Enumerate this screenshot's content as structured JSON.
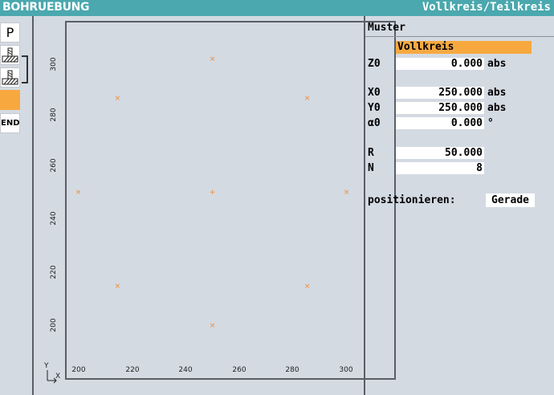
{
  "header": {
    "title": "BOHRUEBUNG",
    "mode": "Vollkreis/Teilkreis"
  },
  "sidebar": {
    "items": [
      {
        "label": "P",
        "icon": "program-icon"
      },
      {
        "icon": "drilling-icon"
      },
      {
        "icon": "drilling-icon"
      },
      {
        "icon": "active-slot"
      },
      {
        "label": "END",
        "icon": "end-icon"
      }
    ]
  },
  "plot": {
    "x_ticks": [
      "200",
      "220",
      "240",
      "260",
      "280",
      "300"
    ],
    "y_ticks": [
      "300",
      "280",
      "260",
      "240",
      "220",
      "200"
    ],
    "axis_x": "X",
    "axis_y": "Y",
    "marker_color": "#f08a30"
  },
  "chart_data": {
    "type": "scatter",
    "x": [
      250,
      285.36,
      300,
      285.36,
      250,
      214.64,
      200,
      214.64,
      250
    ],
    "y": [
      300,
      285.36,
      250,
      214.64,
      200,
      214.64,
      250,
      285.36,
      250
    ],
    "xlim": [
      195,
      305
    ],
    "ylim": [
      190,
      315
    ]
  },
  "panel": {
    "heading": "Muster",
    "pattern": "Vollkreis",
    "fields": [
      {
        "label": "Z0",
        "value": "0.000",
        "unit": "abs"
      },
      {
        "label": "X0",
        "value": "250.000",
        "unit": "abs"
      },
      {
        "label": "Y0",
        "value": "250.000",
        "unit": "abs"
      },
      {
        "label": "α0",
        "value": "0.000",
        "unit": "°"
      },
      {
        "label": "R",
        "value": "50.000",
        "unit": ""
      },
      {
        "label": "N",
        "value": "8",
        "unit": ""
      }
    ],
    "positioning_label": "positionieren:",
    "positioning_value": "Gerade"
  },
  "colors": {
    "titlebar": "#4aa8ae",
    "accent": "#f7a940",
    "background": "#d4dae2"
  }
}
